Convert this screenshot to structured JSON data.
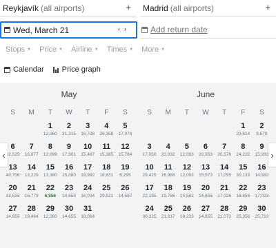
{
  "origin": {
    "city": "Reykjavík",
    "hint": "(all airports)",
    "add": "+"
  },
  "destination": {
    "city": "Madrid",
    "hint": "(all airports)",
    "add": "+"
  },
  "depart": {
    "value": "Wed, March 21",
    "prev": "‹",
    "next": "›"
  },
  "return_date": {
    "placeholder": "Add return date"
  },
  "filters": [
    "Stops",
    "Price",
    "Airline",
    "Times",
    "More"
  ],
  "views": {
    "calendar": "Calendar",
    "price_graph": "Price graph"
  },
  "weekdays": [
    "S",
    "M",
    "T",
    "W",
    "T",
    "F",
    "S"
  ],
  "nav": {
    "prev": "‹",
    "next": "›"
  },
  "months": [
    {
      "name": "May",
      "days": [
        {
          "d": "",
          "p": ""
        },
        {
          "d": "",
          "p": ""
        },
        {
          "d": "1",
          "p": "12,060"
        },
        {
          "d": "2",
          "p": "31,315"
        },
        {
          "d": "3",
          "p": "16,728"
        },
        {
          "d": "4",
          "p": "26,358"
        },
        {
          "d": "5",
          "p": "17,078"
        },
        {
          "d": "6",
          "p": "32,525"
        },
        {
          "d": "7",
          "p": "16,877"
        },
        {
          "d": "8",
          "p": "12,099"
        },
        {
          "d": "9",
          "p": "17,501"
        },
        {
          "d": "10",
          "p": "15,487"
        },
        {
          "d": "11",
          "p": "15,385"
        },
        {
          "d": "12",
          "p": "15,784"
        },
        {
          "d": "13",
          "p": "40,706"
        },
        {
          "d": "14",
          "p": "13,229"
        },
        {
          "d": "15",
          "p": "13,380"
        },
        {
          "d": "16",
          "p": "15,080"
        },
        {
          "d": "17",
          "p": "18,982"
        },
        {
          "d": "18",
          "p": "18,631"
        },
        {
          "d": "19",
          "p": "8,295"
        },
        {
          "d": "20",
          "p": "32,525"
        },
        {
          "d": "21",
          "p": "16,779"
        },
        {
          "d": "22",
          "p": "6,556",
          "low": true
        },
        {
          "d": "23",
          "p": "14,655"
        },
        {
          "d": "24",
          "p": "16,004"
        },
        {
          "d": "25",
          "p": "29,521"
        },
        {
          "d": "26",
          "p": "14,587"
        },
        {
          "d": "27",
          "p": "14,655"
        },
        {
          "d": "28",
          "p": "19,464"
        },
        {
          "d": "29",
          "p": "12,060"
        },
        {
          "d": "30",
          "p": "14,655"
        },
        {
          "d": "31",
          "p": "18,064"
        }
      ]
    },
    {
      "name": "June",
      "days": [
        {
          "d": "",
          "p": ""
        },
        {
          "d": "",
          "p": ""
        },
        {
          "d": "",
          "p": ""
        },
        {
          "d": "",
          "p": ""
        },
        {
          "d": "",
          "p": ""
        },
        {
          "d": "1",
          "p": "23,614"
        },
        {
          "d": "2",
          "p": "9,578"
        },
        {
          "d": "3",
          "p": "17,050"
        },
        {
          "d": "4",
          "p": "20,332"
        },
        {
          "d": "5",
          "p": "12,093"
        },
        {
          "d": "6",
          "p": "20,953"
        },
        {
          "d": "7",
          "p": "20,576"
        },
        {
          "d": "8",
          "p": "24,222"
        },
        {
          "d": "9",
          "p": "15,933"
        },
        {
          "d": "10",
          "p": "29,425"
        },
        {
          "d": "11",
          "p": "16,988"
        },
        {
          "d": "12",
          "p": "12,093"
        },
        {
          "d": "13",
          "p": "15,573"
        },
        {
          "d": "14",
          "p": "17,055"
        },
        {
          "d": "15",
          "p": "30,133"
        },
        {
          "d": "16",
          "p": "14,583"
        },
        {
          "d": "17",
          "p": "22,155"
        },
        {
          "d": "18",
          "p": "19,786"
        },
        {
          "d": "19",
          "p": "14,582"
        },
        {
          "d": "20",
          "p": "14,655"
        },
        {
          "d": "21",
          "p": "17,026"
        },
        {
          "d": "22",
          "p": "18,656"
        },
        {
          "d": "23",
          "p": "17,023"
        },
        {
          "d": "24",
          "p": "30,325"
        },
        {
          "d": "25",
          "p": "21,817"
        },
        {
          "d": "26",
          "p": "18,233"
        },
        {
          "d": "27",
          "p": "14,655"
        },
        {
          "d": "28",
          "p": "21,072"
        },
        {
          "d": "29",
          "p": "25,356"
        },
        {
          "d": "30",
          "p": "25,713"
        }
      ]
    }
  ]
}
